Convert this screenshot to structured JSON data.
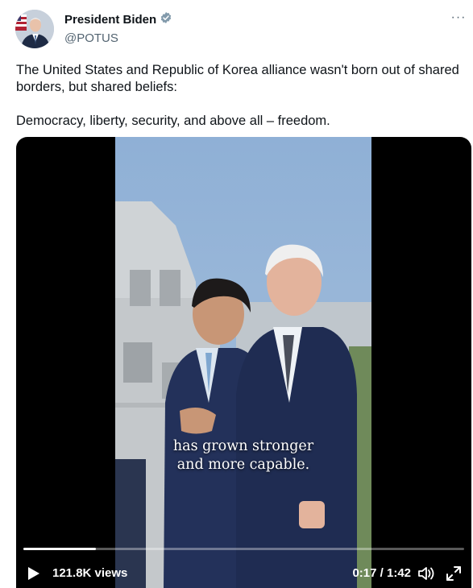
{
  "author": {
    "name": "President Biden",
    "handle": "@POTUS",
    "verified": true,
    "verified_color": "#829aab"
  },
  "post": {
    "line1": "The United States and Republic of Korea alliance wasn't born out of shared borders, but shared beliefs:",
    "line2": "Democracy, liberty, security, and above all – freedom."
  },
  "video": {
    "caption_line1": "has grown stronger",
    "caption_line2": "and more capable.",
    "views": "121.8K views",
    "time": "0:17 / 1:42",
    "progress_fraction": 0.165
  },
  "icons": {
    "more": "more-options-icon",
    "play": "play-icon",
    "volume": "volume-icon",
    "expand": "fullscreen-icon"
  }
}
